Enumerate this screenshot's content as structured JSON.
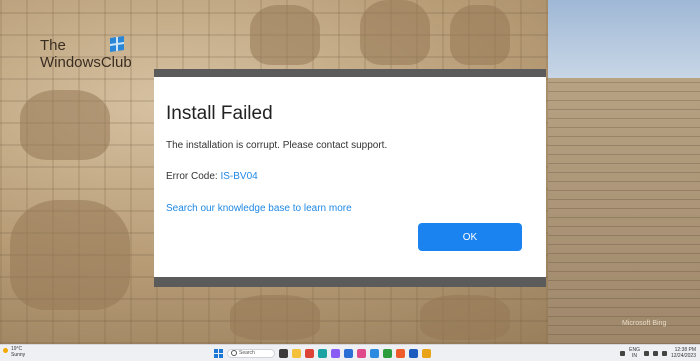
{
  "watermark": {
    "line1": "The",
    "line2": "WindowsClub"
  },
  "dialog": {
    "title": "Install Failed",
    "message": "The installation is corrupt. Please contact support.",
    "error_label": "Error Code:",
    "error_code": "IS-BV04",
    "kb_link": "Search our knowledge base to learn more",
    "ok_label": "OK"
  },
  "desktop": {
    "bing_label": "Microsoft Bing"
  },
  "taskbar": {
    "weather_temp": "19°C",
    "weather_desc": "Sunny",
    "search_placeholder": "Search",
    "language_line1": "ENG",
    "language_line2": "IN",
    "time": "12:38 PM",
    "date": "12/24/2023",
    "apps": [
      {
        "name": "task-view-icon",
        "color": "#3b3b3b"
      },
      {
        "name": "file-explorer-icon",
        "color": "#f3c13a"
      },
      {
        "name": "chrome-icon",
        "color": "#db4437"
      },
      {
        "name": "edge-icon",
        "color": "#1ba3a3"
      },
      {
        "name": "copilot-icon",
        "color": "#8a5cf6"
      },
      {
        "name": "store-icon",
        "color": "#2b6fd6"
      },
      {
        "name": "photos-icon",
        "color": "#e04a8a"
      },
      {
        "name": "mail-icon",
        "color": "#2a8be0"
      },
      {
        "name": "xbox-icon",
        "color": "#2e9d3e"
      },
      {
        "name": "brave-icon",
        "color": "#ef5b2a"
      },
      {
        "name": "word-icon",
        "color": "#1e5bbf"
      },
      {
        "name": "chrome-canary-icon",
        "color": "#e8a317"
      }
    ]
  }
}
